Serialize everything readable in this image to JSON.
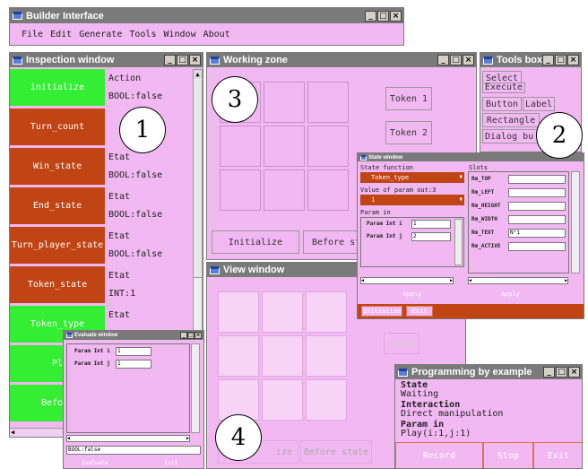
{
  "builder": {
    "title": "Builder Interface",
    "menu": [
      "File",
      "Edit",
      "Generate",
      "Tools",
      "Window",
      "About"
    ]
  },
  "window_buttons": [
    "_",
    "□",
    "×"
  ],
  "inspection": {
    "title": "Inspection window",
    "rows": [
      {
        "name": "initialize",
        "type": "Action",
        "value": "BOOL:false",
        "color": "green"
      },
      {
        "name": "Turn_count",
        "type": "",
        "value": "",
        "color": "red"
      },
      {
        "name": "Win_state",
        "type": "Etat",
        "value": "BOOL:false",
        "color": "red"
      },
      {
        "name": "End_state",
        "type": "Etat",
        "value": "BOOL:false",
        "color": "red"
      },
      {
        "name": "Turn_player_state",
        "type": "Etat",
        "value": "BOOL:false",
        "color": "red"
      },
      {
        "name": "Token_state",
        "type": "Etat",
        "value": "INT:1",
        "color": "red"
      },
      {
        "name": "Token_type",
        "type": "Etat",
        "value": "",
        "color": "green"
      },
      {
        "name": "Pl",
        "type": "",
        "value": "",
        "color": "green"
      },
      {
        "name": "Before",
        "type": "",
        "value": "",
        "color": "green"
      }
    ]
  },
  "working": {
    "title": "Working zone",
    "tokens": [
      "Token 1",
      "Token 2"
    ],
    "initialize": "Initialize",
    "before_state": "Before st"
  },
  "tools": {
    "title": "Tools box",
    "items": [
      "Select",
      "Execute",
      "Button",
      "Label",
      "Rectangle",
      "Dialog bu"
    ]
  },
  "state": {
    "title": "State window",
    "state_function_label": "State function",
    "state_function_value": "Token_type",
    "param_out_label": "Value of param out:3",
    "param_out_value": "1",
    "param_in_label": "Param in",
    "params": [
      {
        "label": "Param Int i",
        "value": "1"
      },
      {
        "label": "Param Int j",
        "value": "2"
      }
    ],
    "slots_label": "Slots",
    "slots": [
      {
        "label": "Rm_TOP",
        "value": ""
      },
      {
        "label": "Rm_LEFT",
        "value": ""
      },
      {
        "label": "Rm_HEIGHT",
        "value": ""
      },
      {
        "label": "Rm_WIDTH",
        "value": ""
      },
      {
        "label": "Rm_TEXT",
        "value": "N°1"
      },
      {
        "label": "Rm_ACTIVE",
        "value": ""
      }
    ],
    "apply": "Apply",
    "initialize": "Initialize",
    "exit": "Exit"
  },
  "view": {
    "title": "View window",
    "token_partial": "Token 1",
    "initialize_partial": "ize",
    "before_state": "Before state"
  },
  "evaluate": {
    "title": "Evaluate window",
    "params": [
      {
        "label": "Param Int i",
        "value": "1"
      },
      {
        "label": "Param Int j",
        "value": "1"
      }
    ],
    "result": "BOOL:false",
    "evaluate": "Evaluate",
    "exit": "Exit"
  },
  "programming": {
    "title": "Programming by example",
    "state_label": "State",
    "state_value": "Waiting",
    "interaction_label": "Interaction",
    "interaction_value": "Direct manipulation",
    "param_label": "Param in",
    "param_value": "Play(i:1,j:1)",
    "record": "Record",
    "stop": "Stop",
    "exit": "Exit"
  },
  "callouts": [
    "1",
    "2",
    "3",
    "4"
  ],
  "colors": {
    "window_bg": "#f2b8f2",
    "titlebar": "#7a7a7a",
    "action_red": "#c04414",
    "action_green": "#33ee33",
    "window_icon": "#5a7fd8"
  }
}
